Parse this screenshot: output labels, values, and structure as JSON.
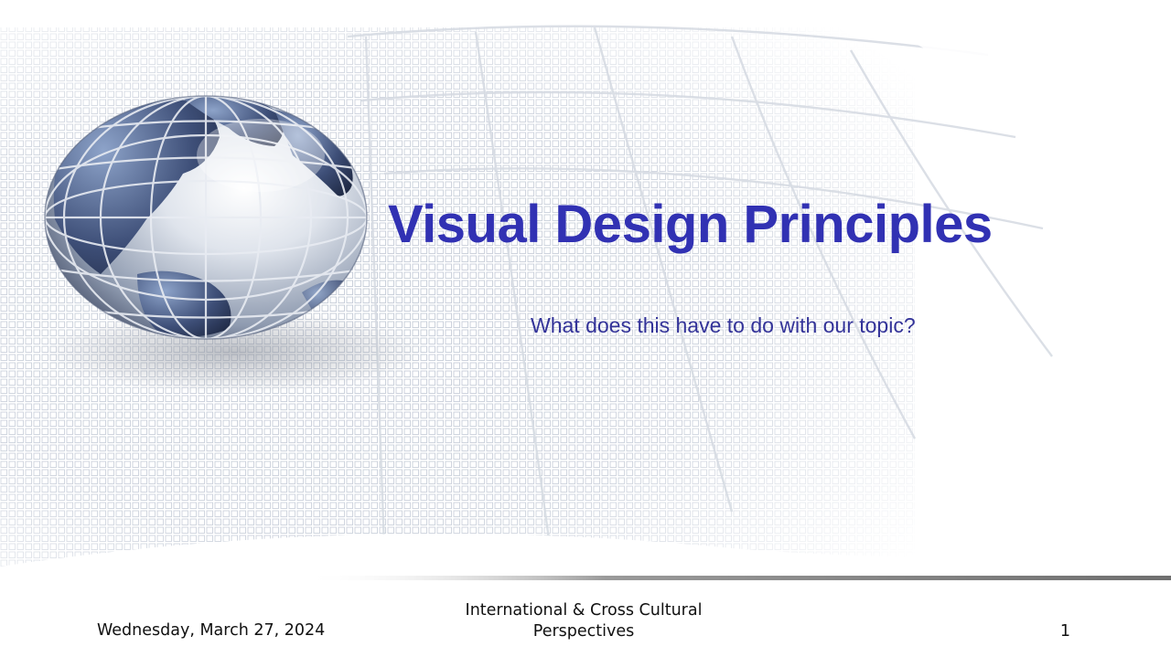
{
  "slide": {
    "title": "Visual Design Principles",
    "subtitle": "What does this have to do with our topic?",
    "footer": {
      "date": "Wednesday, March 27, 2024",
      "course": "International & Cross Cultural Perspectives",
      "page_number": "1"
    }
  },
  "colors": {
    "title": "#3131b3",
    "subtitle": "#333399",
    "footer_text": "#111111",
    "grid": "#c9d0da",
    "divider": "#8a8a8a"
  },
  "icons": {
    "globe": "globe-icon"
  }
}
